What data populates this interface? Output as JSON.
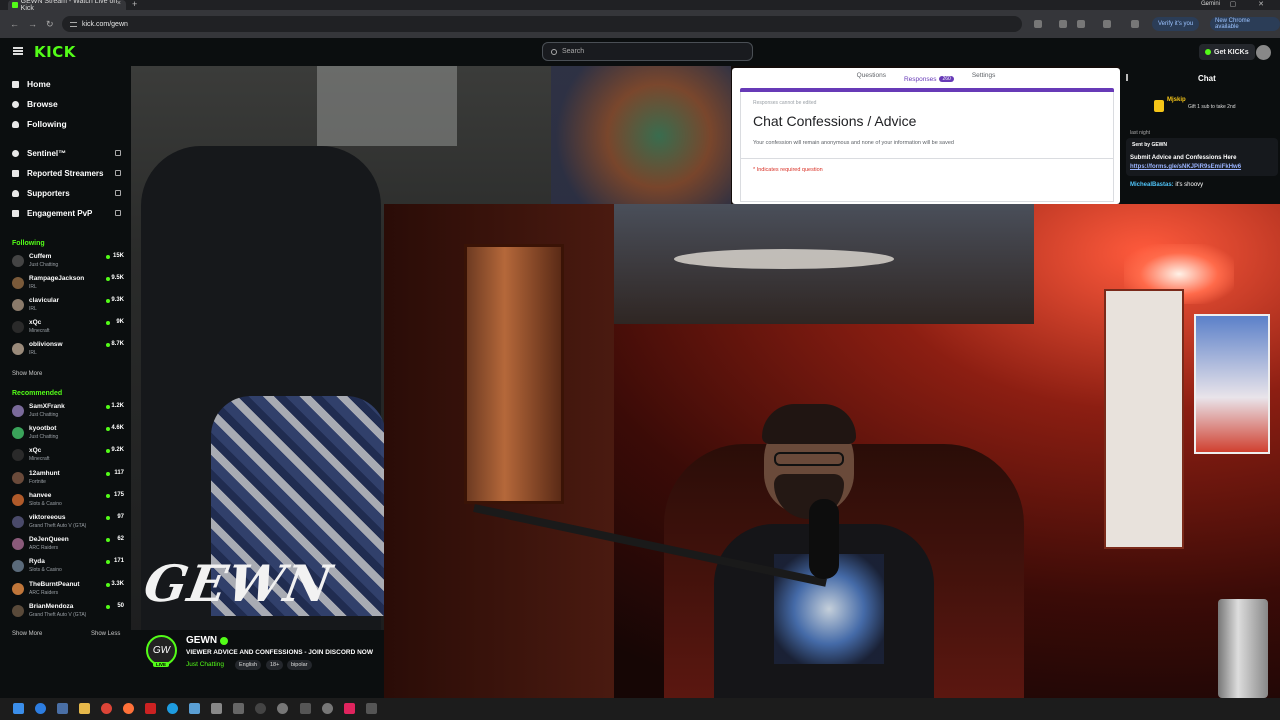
{
  "browser": {
    "tab_title": "GEWN Stream - Watch Live on Kick",
    "tab_close": "×",
    "tab_new": "+",
    "profile": "Gemini",
    "url": "kick.com/gewn",
    "verify_label": "Verify it's you",
    "update_label": "New Chrome available"
  },
  "kick": {
    "logo": "KICK",
    "search_placeholder": "Search",
    "get_kicks_label": "Get KICKs",
    "brand_color": "#53fc18"
  },
  "sidebar": {
    "nav": [
      {
        "label": "Home",
        "icon": "home-icon"
      },
      {
        "label": "Browse",
        "icon": "compass-icon"
      },
      {
        "label": "Following",
        "icon": "heart-icon"
      }
    ],
    "extensions": [
      {
        "label": "Sentinel™",
        "icon": "shield-icon"
      },
      {
        "label": "Reported Streamers",
        "icon": "flag-icon"
      },
      {
        "label": "Supporters",
        "icon": "heart-icon"
      },
      {
        "label": "Engagement PvP",
        "icon": "swords-icon"
      }
    ],
    "following_label": "Following",
    "following": [
      {
        "name": "Cuffem",
        "category": "Just Chatting",
        "viewers": "15K",
        "color": "#444"
      },
      {
        "name": "RampageJackson",
        "category": "IRL",
        "viewers": "9.5K",
        "color": "#7a5a3a"
      },
      {
        "name": "clavicular",
        "category": "IRL",
        "viewers": "9.3K",
        "color": "#8a7a6a"
      },
      {
        "name": "xQc",
        "category": "Minecraft",
        "viewers": "9K",
        "color": "#2a2a2a"
      },
      {
        "name": "oblivionsw",
        "category": "IRL",
        "viewers": "8.7K",
        "color": "#9a8a7a"
      }
    ],
    "show_more": "Show More",
    "recommended_label": "Recommended",
    "recommended": [
      {
        "name": "SamXFrank",
        "category": "Just Chatting",
        "viewers": "1.2K",
        "color": "#7a6a9a"
      },
      {
        "name": "kyootbot",
        "category": "Just Chatting",
        "viewers": "4.6K",
        "color": "#3aa35a"
      },
      {
        "name": "xQc",
        "category": "Minecraft",
        "viewers": "9.2K",
        "color": "#2a2a2a"
      },
      {
        "name": "12amhunt",
        "category": "Fortnite",
        "viewers": "117",
        "color": "#6a4a3a"
      },
      {
        "name": "hanvee",
        "category": "Slots & Casino",
        "viewers": "175",
        "color": "#b05a2a"
      },
      {
        "name": "viktoreeous",
        "category": "Grand Theft Auto V (GTA)",
        "viewers": "97",
        "color": "#4a4a6a"
      },
      {
        "name": "DeJenQueen",
        "category": "ARC Raiders",
        "viewers": "62",
        "color": "#8a5a7a"
      },
      {
        "name": "Ryda",
        "category": "Slots & Casino",
        "viewers": "171",
        "color": "#5a6a7a"
      },
      {
        "name": "TheBurntPeanut",
        "category": "ARC Raiders",
        "viewers": "3.3K",
        "color": "#c0763a"
      },
      {
        "name": "BrianMendoza",
        "category": "Grand Theft Auto V (GTA)",
        "viewers": "50",
        "color": "#5a4a3a"
      }
    ],
    "show_more_2": "Show More",
    "show_less": "Show Less"
  },
  "stream": {
    "watermark": "GEWN",
    "form": {
      "tabs": [
        "Questions",
        "Responses",
        "Settings"
      ],
      "responses_count": "260",
      "note": "Responses cannot be edited",
      "title": "Chat Confessions / Advice",
      "description": "Your confession will remain anonymous and none of your information will be saved",
      "required": "* Indicates required question"
    }
  },
  "chat": {
    "title": "Chat",
    "gift_user": "Mjskip",
    "gift_text": "Gift 1 sub to take 2nd",
    "pinned_label": "last night",
    "pinned_sender": "Sent by GEWN",
    "pinned_text": "Submit Advice and Confessions Here",
    "pinned_link": "https://forms.gle/sNKJPiR9sEmiFkHw6",
    "messages": [
      {
        "user": "MichealBastas:",
        "text": "it's shoovy"
      }
    ]
  },
  "channel": {
    "name": "GEWN",
    "avatar_text": "GW",
    "live": "LIVE",
    "title": "VIEWER ADVICE AND CONFESSIONS - JOIN DISCORD NOW",
    "category": "Just Chatting",
    "tags": [
      "English",
      "18+",
      "bipolar"
    ]
  }
}
